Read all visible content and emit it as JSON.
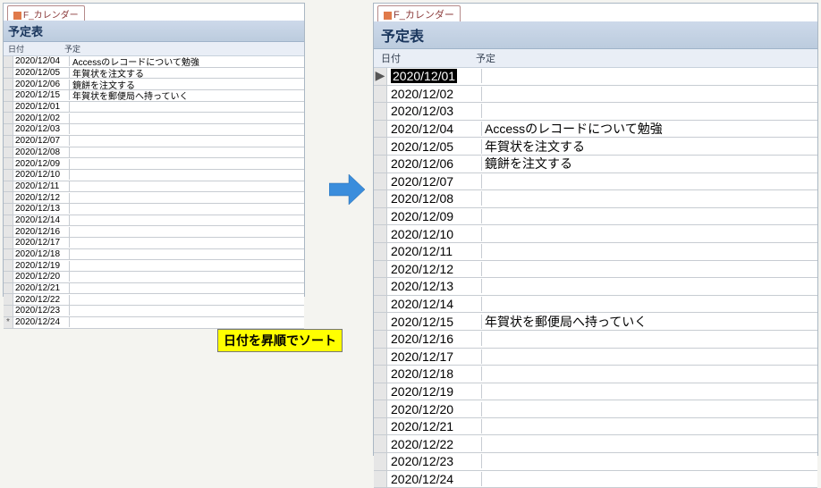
{
  "tab_label": "F_カレンダー",
  "title": "予定表",
  "header": {
    "date": "日付",
    "event": "予定"
  },
  "annotation": "日付を昇順でソート",
  "left_rows": [
    {
      "sel": "",
      "date": "2020/12/04",
      "event": "Accessのレコードについて勉強"
    },
    {
      "sel": "",
      "date": "2020/12/05",
      "event": "年賀状を注文する"
    },
    {
      "sel": "",
      "date": "2020/12/06",
      "event": "鏡餅を注文する"
    },
    {
      "sel": "",
      "date": "2020/12/15",
      "event": "年賀状を郵便局へ持っていく"
    },
    {
      "sel": "",
      "date": "2020/12/01",
      "event": ""
    },
    {
      "sel": "",
      "date": "2020/12/02",
      "event": ""
    },
    {
      "sel": "",
      "date": "2020/12/03",
      "event": ""
    },
    {
      "sel": "",
      "date": "2020/12/07",
      "event": ""
    },
    {
      "sel": "",
      "date": "2020/12/08",
      "event": ""
    },
    {
      "sel": "",
      "date": "2020/12/09",
      "event": ""
    },
    {
      "sel": "",
      "date": "2020/12/10",
      "event": ""
    },
    {
      "sel": "",
      "date": "2020/12/11",
      "event": ""
    },
    {
      "sel": "",
      "date": "2020/12/12",
      "event": ""
    },
    {
      "sel": "",
      "date": "2020/12/13",
      "event": ""
    },
    {
      "sel": "",
      "date": "2020/12/14",
      "event": ""
    },
    {
      "sel": "",
      "date": "2020/12/16",
      "event": ""
    },
    {
      "sel": "",
      "date": "2020/12/17",
      "event": ""
    },
    {
      "sel": "",
      "date": "2020/12/18",
      "event": ""
    },
    {
      "sel": "",
      "date": "2020/12/19",
      "event": ""
    },
    {
      "sel": "",
      "date": "2020/12/20",
      "event": ""
    },
    {
      "sel": "",
      "date": "2020/12/21",
      "event": ""
    },
    {
      "sel": "",
      "date": "2020/12/22",
      "event": ""
    },
    {
      "sel": "",
      "date": "2020/12/23",
      "event": ""
    },
    {
      "sel": "*",
      "date": "2020/12/24",
      "event": ""
    }
  ],
  "right_rows": [
    {
      "sel": "▶",
      "date": "2020/12/01",
      "event": "",
      "hl": true
    },
    {
      "sel": "",
      "date": "2020/12/02",
      "event": ""
    },
    {
      "sel": "",
      "date": "2020/12/03",
      "event": ""
    },
    {
      "sel": "",
      "date": "2020/12/04",
      "event": "Accessのレコードについて勉強"
    },
    {
      "sel": "",
      "date": "2020/12/05",
      "event": "年賀状を注文する"
    },
    {
      "sel": "",
      "date": "2020/12/06",
      "event": "鏡餅を注文する"
    },
    {
      "sel": "",
      "date": "2020/12/07",
      "event": ""
    },
    {
      "sel": "",
      "date": "2020/12/08",
      "event": ""
    },
    {
      "sel": "",
      "date": "2020/12/09",
      "event": ""
    },
    {
      "sel": "",
      "date": "2020/12/10",
      "event": ""
    },
    {
      "sel": "",
      "date": "2020/12/11",
      "event": ""
    },
    {
      "sel": "",
      "date": "2020/12/12",
      "event": ""
    },
    {
      "sel": "",
      "date": "2020/12/13",
      "event": ""
    },
    {
      "sel": "",
      "date": "2020/12/14",
      "event": ""
    },
    {
      "sel": "",
      "date": "2020/12/15",
      "event": "年賀状を郵便局へ持っていく"
    },
    {
      "sel": "",
      "date": "2020/12/16",
      "event": ""
    },
    {
      "sel": "",
      "date": "2020/12/17",
      "event": ""
    },
    {
      "sel": "",
      "date": "2020/12/18",
      "event": ""
    },
    {
      "sel": "",
      "date": "2020/12/19",
      "event": ""
    },
    {
      "sel": "",
      "date": "2020/12/20",
      "event": ""
    },
    {
      "sel": "",
      "date": "2020/12/21",
      "event": ""
    },
    {
      "sel": "",
      "date": "2020/12/22",
      "event": ""
    },
    {
      "sel": "",
      "date": "2020/12/23",
      "event": ""
    },
    {
      "sel": "",
      "date": "2020/12/24",
      "event": ""
    }
  ]
}
